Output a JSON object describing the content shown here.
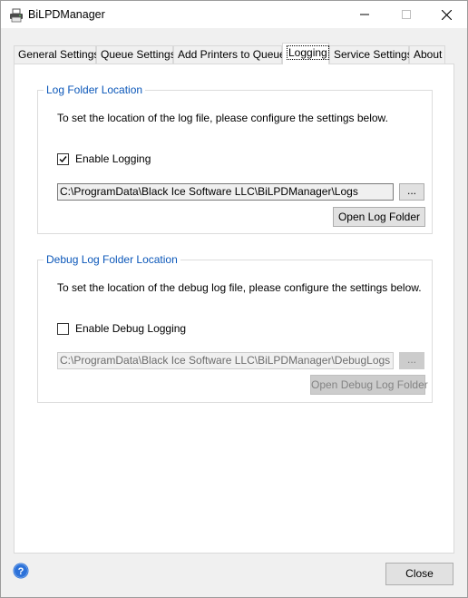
{
  "window": {
    "title": "BiLPDManager",
    "icon": "printer-app-icon"
  },
  "tabs": [
    {
      "label": "General Settings",
      "active": false
    },
    {
      "label": "Queue Settings",
      "active": false
    },
    {
      "label": "Add Printers to Queues",
      "active": false
    },
    {
      "label": "Logging",
      "active": true
    },
    {
      "label": "Service Settings",
      "active": false
    },
    {
      "label": "About",
      "active": false
    }
  ],
  "log_group": {
    "title": "Log Folder Location",
    "description": "To set the location of the log file, please configure the settings below.",
    "enable_label": "Enable Logging",
    "enabled": true,
    "path": "C:\\ProgramData\\Black Ice Software LLC\\BiLPDManager\\Logs",
    "browse_label": "...",
    "open_label": "Open Log Folder"
  },
  "debug_group": {
    "title": "Debug Log Folder Location",
    "description": "To set the location of the debug log file, please configure the settings below.",
    "enable_label": "Enable Debug Logging",
    "enabled": false,
    "path": "C:\\ProgramData\\Black Ice Software LLC\\BiLPDManager\\DebugLogs",
    "browse_label": "...",
    "open_label": "Open Debug Log Folder"
  },
  "footer": {
    "close_label": "Close",
    "help_icon": "help-icon"
  },
  "colors": {
    "group_title": "#0b57b9",
    "help_icon": "#2d72d9"
  }
}
